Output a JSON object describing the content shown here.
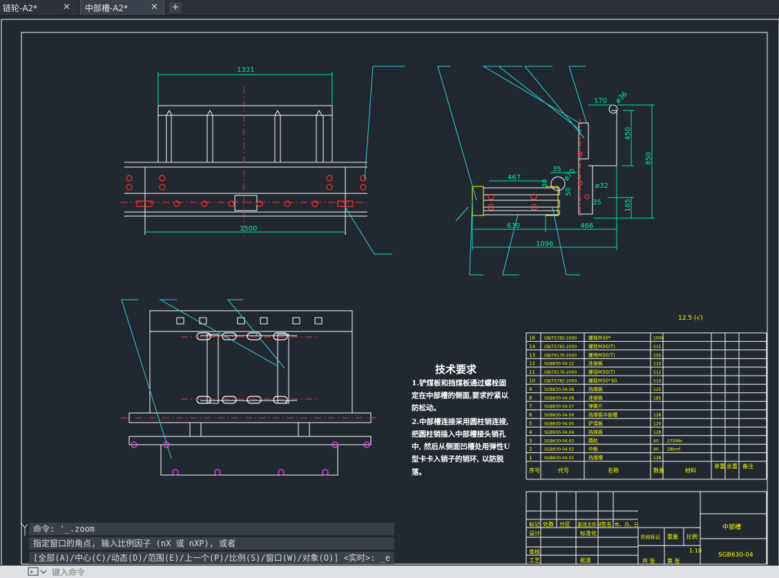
{
  "tabs": [
    {
      "label": "链轮-A2*"
    },
    {
      "label": "中部槽-A2*"
    }
  ],
  "tab_close": "✕",
  "tab_add": "+",
  "dims": {
    "d1331": "1331",
    "d1500": "1500",
    "d467": "467",
    "d35": "35",
    "d70": "ø70",
    "d30": "30",
    "d50": "50",
    "d32": "ø32",
    "d35b": "35",
    "d630": "630",
    "d466": "466",
    "d1096": "1096",
    "d170": "170",
    "d36": "ø36",
    "d450": "450",
    "d850": "850",
    "d165": "165"
  },
  "roughness": "12.5 (√)",
  "tech": {
    "title": "技术要求",
    "lines": [
      "1.铲煤板和挡煤板通过螺栓固",
      "定在中部槽的侧面,要求拧紧以",
      "防松动。",
      "2.中部槽连接采用圆柱销连接,",
      "把圆柱销插入中部槽接头销孔",
      "中, 然后从侧面凹槽处用弹性U",
      "型卡卡入销子的销环, 以防脱",
      "落。"
    ]
  },
  "bom": {
    "rows": [
      [
        "16",
        "GB/T5782-2000",
        "螺栓M30*",
        "",
        "1000",
        ""
      ],
      [
        "14",
        "GB/T5783-2000",
        "螺栓M30(T)",
        "",
        "515",
        ""
      ],
      [
        "13",
        "GB/T6170-2000",
        "螺母M30(T)",
        "",
        "1SS",
        ""
      ],
      [
        "12",
        "SGB630-04.12",
        "连接板",
        "",
        "110",
        ""
      ],
      [
        "11",
        "GB/T6170-2000",
        "螺母M30(T)",
        "",
        "512",
        ""
      ],
      [
        "10",
        "GB/T5782-2000",
        "螺栓M30*30",
        "",
        "510",
        ""
      ],
      [
        "9",
        "SGB630-04.09",
        "挡煤板",
        "",
        "125",
        ""
      ],
      [
        "8",
        "SGB630-04.08",
        "连接板",
        "",
        "185",
        ""
      ],
      [
        "7",
        "SGB630-04.07",
        "弹簧片",
        "",
        "",
        ""
      ],
      [
        "6",
        "SGB630-04.06",
        "挡煤板中部槽",
        "",
        "128",
        ""
      ],
      [
        "5",
        "SGB630-04.05",
        "铲煤板",
        "",
        "120",
        ""
      ],
      [
        "4",
        "SGB630-04.04",
        "挡煤板",
        "",
        "128",
        ""
      ],
      [
        "3",
        "SGB630-04.03",
        "圆柱",
        "",
        "40",
        "27SiMn"
      ],
      [
        "2",
        "SGB630-04.02",
        "中板",
        "",
        "40",
        "28kmf"
      ],
      [
        "1",
        "SGB630-04.01",
        "挡煤槽",
        "",
        "128",
        ""
      ]
    ],
    "header": [
      "序号",
      "代号",
      "名称",
      "数量",
      "材料",
      "单重",
      "总重",
      "备注"
    ]
  },
  "titleblock": {
    "name": "中部槽",
    "code": "SGB630-04",
    "scale": "1:10",
    "labels": [
      "标记",
      "处数",
      "分区",
      "更改文件号",
      "签名",
      "年、月、日",
      "设计",
      "标准化",
      "阶段标记",
      "重量",
      "比例",
      "审核",
      "工艺",
      "批准",
      "共  张",
      "第  张"
    ]
  },
  "command": {
    "history": [
      "命令: '_.zoom",
      "指定窗口的角点, 输入比例因子 (nX 或 nXP), 或者",
      "[全部(A)/中心(C)/动态(D)/范围(E)/上一个(P)/比例(S)/窗口(W)/对象(O)] <实时>: _e"
    ],
    "placeholder": "键入命令"
  },
  "colors": {
    "bg": "#212830",
    "line": "#ffffff",
    "dim": "#00e6a8",
    "leader": "#2fd4d4",
    "center": "#ff3030",
    "text": "#ffff00",
    "magenta": "#ff3cff"
  }
}
